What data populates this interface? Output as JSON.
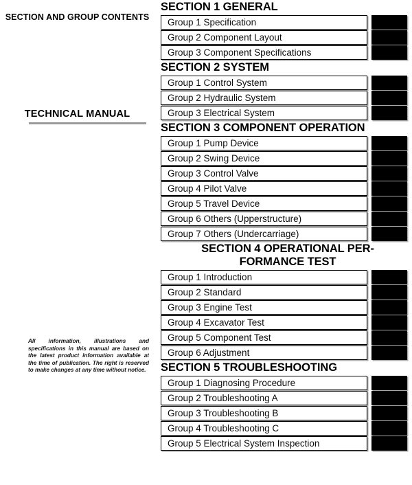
{
  "sidebar": {
    "contents_title": "SECTION AND GROUP\nCONTENTS",
    "manual_title": "TECHNICAL MANUAL",
    "disclaimer": "All information, illustrations and specifications in this manual are based on the latest product information available at the time of publication. The right is reserved to make changes at any time without notice."
  },
  "contents": {
    "sections": [
      {
        "heading": "SECTION 1 GENERAL",
        "centered": false,
        "groups": [
          "Group 1 Specification",
          "Group 2 Component Layout",
          "Group 3 Component Specifications"
        ]
      },
      {
        "heading": "SECTION 2 SYSTEM",
        "centered": false,
        "groups": [
          "Group 1 Control System",
          "Group 2 Hydraulic System",
          "Group 3 Electrical System"
        ]
      },
      {
        "heading": "SECTION 3 COMPONENT OPERATION",
        "centered": false,
        "groups": [
          "Group 1 Pump Device",
          "Group 2 Swing Device",
          "Group 3 Control Valve",
          "Group 4 Pilot Valve",
          "Group 5 Travel Device",
          "Group 6 Others (Upperstructure)",
          "Group 7 Others (Undercarriage)"
        ]
      },
      {
        "heading": "SECTION 4  OPERATIONAL PER-\nFORMANCE TEST",
        "centered": true,
        "groups": [
          "Group 1 Introduction",
          "Group 2 Standard",
          "Group 3 Engine Test",
          "Group 4 Excavator Test",
          "Group 5 Component Test",
          "Group 6 Adjustment"
        ]
      },
      {
        "heading": "SECTION 5 TROUBLESHOOTING",
        "centered": false,
        "groups": [
          "Group 1 Diagnosing Procedure",
          "Group 2 Troubleshooting A",
          "Group 3 Troubleshooting B",
          "Group 4 Troubleshooting C",
          "Group 5 Electrical System Inspection"
        ]
      }
    ]
  },
  "colors": {
    "page_marker": "#000000",
    "rule": "#9a9a9a",
    "border": "#000000"
  }
}
